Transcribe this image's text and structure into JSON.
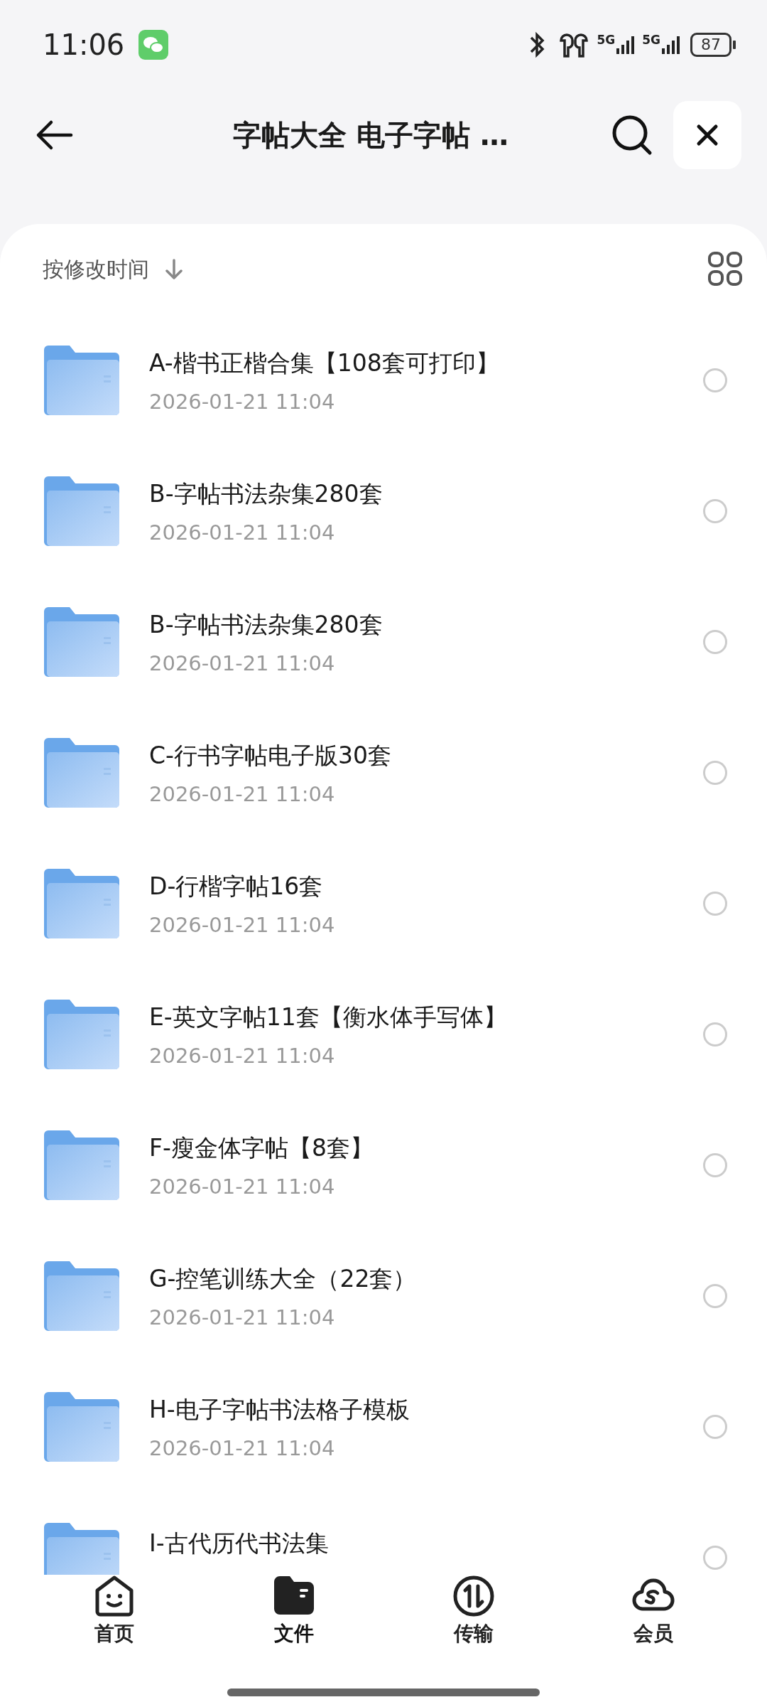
{
  "status_bar": {
    "time": "11:06",
    "networks": [
      "5G",
      "5G"
    ],
    "battery": "87"
  },
  "header": {
    "title": "字帖大全 电子字帖 …"
  },
  "sort": {
    "label": "按修改时间"
  },
  "files": [
    {
      "name": "A-楷书正楷合集【108套可打印】",
      "date": "2026-01-21 11:04",
      "selected": false
    },
    {
      "name": "B-字帖书法杂集280套",
      "date": "2026-01-21 11:04",
      "selected": false
    },
    {
      "name": "B-字帖书法杂集280套",
      "date": "2026-01-21 11:04",
      "selected": false
    },
    {
      "name": "C-行书字帖电子版30套",
      "date": "2026-01-21 11:04",
      "selected": false
    },
    {
      "name": "D-行楷字帖16套",
      "date": "2026-01-21 11:04",
      "selected": false
    },
    {
      "name": "E-英文字帖11套【衡水体手写体】",
      "date": "2026-01-21 11:04",
      "selected": false
    },
    {
      "name": "F-瘦金体字帖【8套】",
      "date": "2026-01-21 11:04",
      "selected": false
    },
    {
      "name": "G-控笔训练大全（22套）",
      "date": "2026-01-21 11:04",
      "selected": false
    },
    {
      "name": "H-电子字帖书法格子模板",
      "date": "2026-01-21 11:04",
      "selected": false
    },
    {
      "name": "I-古代历代书法集",
      "selected": false
    }
  ],
  "nav": [
    {
      "label": "首页",
      "kind": "home",
      "selected": false
    },
    {
      "label": "文件",
      "kind": "files",
      "selected": true
    },
    {
      "label": "传输",
      "kind": "transfer",
      "selected": false
    },
    {
      "label": "会员",
      "kind": "vip",
      "selected": false
    }
  ]
}
